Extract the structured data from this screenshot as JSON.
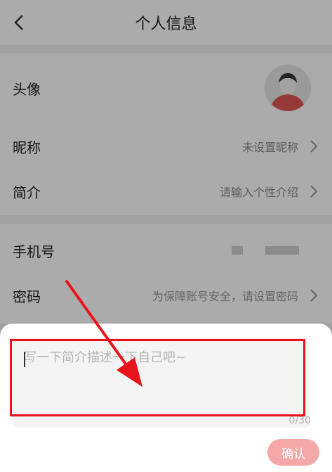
{
  "header": {
    "title": "个人信息"
  },
  "profile": {
    "avatar_label": "头像",
    "nickname_label": "昵称",
    "nickname_value": "未设置昵称",
    "bio_label": "简介",
    "bio_value": "请输入个性介绍",
    "phone_label": "手机号",
    "password_label": "密码",
    "password_value": "为保障账号安全，请设置密码"
  },
  "sheet": {
    "placeholder": "写一下简介描述一下自己吧~",
    "counter": "0/30",
    "confirm_label": "确认"
  },
  "colors": {
    "annotation": "#e8131b",
    "confirm_bg": "#f5a8a8",
    "avatar_shirt": "#e05555"
  },
  "icons": [
    "back-icon",
    "chevron-right-icon",
    "avatar-icon"
  ]
}
